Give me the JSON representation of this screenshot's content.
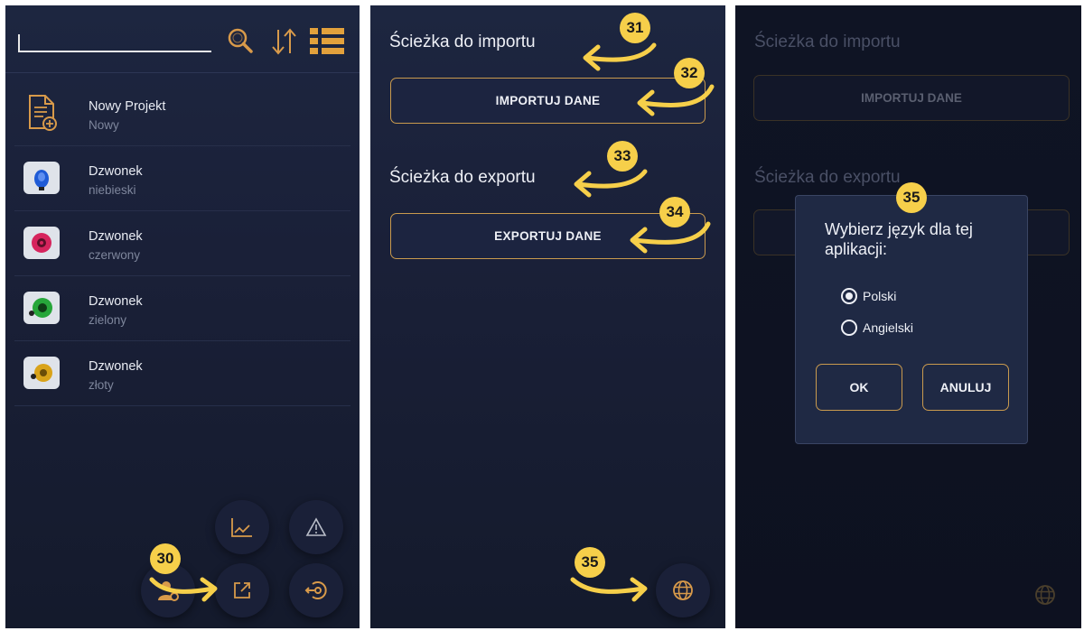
{
  "panel1": {
    "search": {
      "value": ""
    },
    "header_icons": [
      "search-icon",
      "sort-icon",
      "list-view-icon"
    ],
    "items": [
      {
        "title": "Nowy Projekt",
        "subtitle": "Nowy",
        "thumb": "new-document-icon"
      },
      {
        "title": "Dzwonek",
        "subtitle": "niebieski",
        "thumb_color": "#1f5bd6"
      },
      {
        "title": "Dzwonek",
        "subtitle": "czerwony",
        "thumb_color": "#d6245d"
      },
      {
        "title": "Dzwonek",
        "subtitle": "zielony",
        "thumb_color": "#27a63a"
      },
      {
        "title": "Dzwonek",
        "subtitle": "złoty",
        "thumb_color": "#d9a31a"
      }
    ],
    "fab_icons": [
      "chart-icon",
      "warning-icon",
      "user-settings-icon",
      "export-icon",
      "login-icon"
    ],
    "callout": "30"
  },
  "panel2": {
    "import_label": "Ścieżka do importu",
    "import_button": "IMPORTUJ DANE",
    "export_label": "Ścieżka do exportu",
    "export_button": "EXPORTUJ DANE",
    "callouts": [
      "31",
      "32",
      "33",
      "34",
      "35"
    ],
    "globe_icon": "globe-icon"
  },
  "panel3": {
    "import_label": "Ścieżka do importu",
    "import_button": "IMPORTUJ DANE",
    "export_label": "Ścieżka do exportu",
    "dialog": {
      "title": "Wybierz język dla tej aplikacji:",
      "options": [
        {
          "label": "Polski",
          "selected": true
        },
        {
          "label": "Angielski",
          "selected": false
        }
      ],
      "ok": "OK",
      "cancel": "ANULUJ"
    },
    "callout": "35"
  },
  "colors": {
    "accent_gold": "#c99a4e",
    "callout_yellow": "#f6cf4a",
    "panel_bg": "#1d2640"
  }
}
